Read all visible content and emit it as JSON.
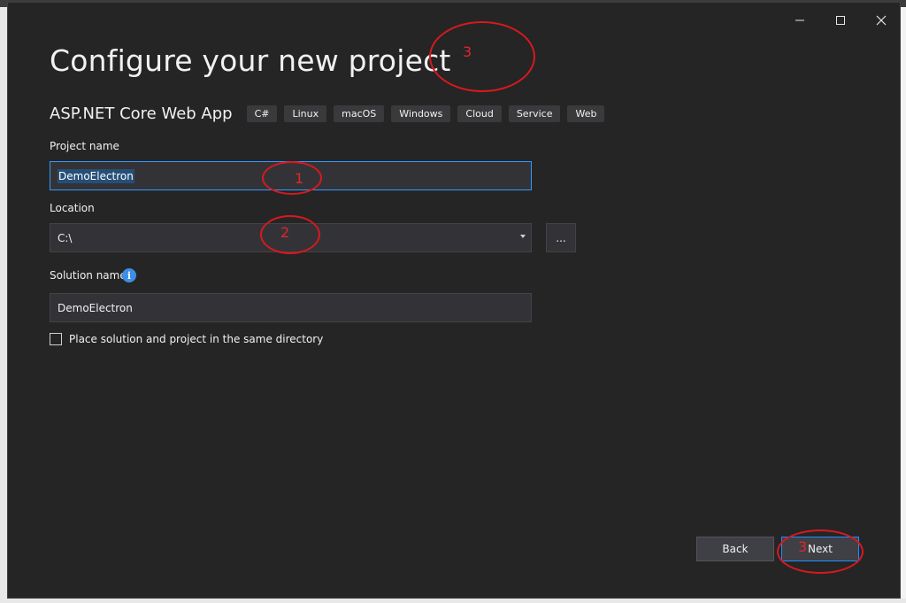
{
  "dialog": {
    "title": "Configure your new project",
    "template_name": "ASP.NET Core Web App",
    "tags": [
      "C#",
      "Linux",
      "macOS",
      "Windows",
      "Cloud",
      "Service",
      "Web"
    ]
  },
  "icons": {
    "minimize": "minimize-icon",
    "maximize": "maximize-icon",
    "close": "close-icon",
    "info": "info-icon",
    "dropdown": "chevron-down-icon"
  },
  "form": {
    "project_name_label": "Project name",
    "project_name_value": "DemoElectron",
    "location_label": "Location",
    "location_value": "C:\\",
    "browse_label": "...",
    "solution_name_label": "Solution name",
    "solution_name_value": "DemoElectron",
    "info_glyph": "i",
    "same_dir_label": "Place solution and project in the same directory",
    "same_dir_checked": false
  },
  "footer": {
    "back_label": "Back",
    "next_label": "Next"
  },
  "annotations": {
    "title_marker": "3",
    "project_marker": "1",
    "location_marker": "2",
    "next_marker": "3"
  },
  "colors": {
    "dialog_bg": "#252526",
    "input_bg": "#333337",
    "focus_border": "#3399ff",
    "annotation_red": "#d8191e",
    "info_blue": "#3c8ee8"
  }
}
